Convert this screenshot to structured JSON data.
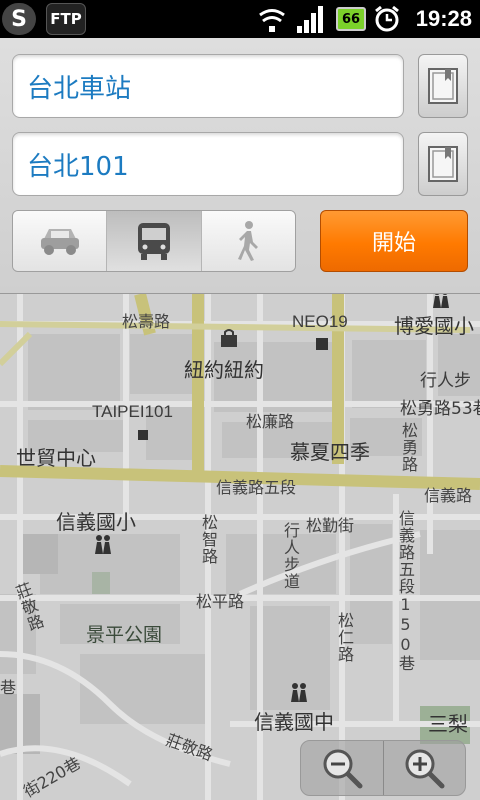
{
  "status_bar": {
    "app_s": "S",
    "app_ftp": "FTP",
    "battery": "66",
    "time": "19:28"
  },
  "route": {
    "from_value": "台北車站",
    "to_value": "台北101",
    "start_label": "開始",
    "selected_mode": "transit",
    "modes": [
      "car",
      "transit",
      "walk"
    ]
  },
  "map": {
    "labels": {
      "songshou_rd": "松壽路",
      "neo19": "NEO19",
      "boai_school": "博愛國小",
      "newyork": "紐約紐約",
      "pedestrian": "行人步",
      "songyong_rd53": "松勇路53巷",
      "taipei101": "TAIPEI101",
      "songlian_rd": "松廉路",
      "world_trade": "世貿中心",
      "muxia": "慕夏四季",
      "songyong_rd": "松勇路",
      "xinyi_sec5": "信義路五段",
      "xinyi_rd_right": "信義路",
      "xinyi_elementary": "信義國小",
      "songqin_st": "松勤街",
      "songzhi_rd": "松智路",
      "ped_walkway": "行人步道",
      "xinyi_sec5_lane150": "信義路五段150巷",
      "songping_rd": "松平路",
      "zhuangjing_rd_left": "莊敬路",
      "jingping_park": "景平公園",
      "songren_rd": "松仁路",
      "xinyi_junior": "信義國中",
      "sanli": "三梨",
      "zhuangjing_rd": "莊敬路",
      "lane220": "街220巷",
      "lane_left": "巷"
    }
  },
  "colors": {
    "accent_text": "#1c7bc1",
    "start_button": "#ff7a00",
    "map_background": "#cfcfcf",
    "major_road": "#c8c27a"
  },
  "icons": {
    "bookmark": "bookmark-icon",
    "car": "car-icon",
    "bus": "bus-icon",
    "walk": "walk-icon",
    "zoom_out": "zoom-out-icon",
    "zoom_in": "zoom-in-icon"
  }
}
